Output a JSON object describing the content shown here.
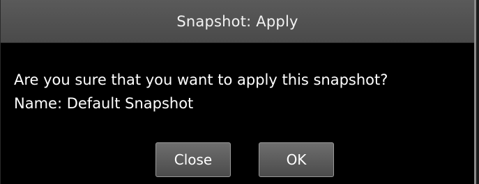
{
  "dialog": {
    "title": "Snapshot: Apply",
    "message_line1": "Are you sure that you want to apply this snapshot?",
    "message_line2": "Name: Default Snapshot"
  },
  "buttons": {
    "close_label": "Close",
    "ok_label": "OK"
  },
  "colors": {
    "titlebar": "#4f4f4f",
    "background": "#000000",
    "button": "#5c5c5c",
    "text": "#ffffff"
  }
}
